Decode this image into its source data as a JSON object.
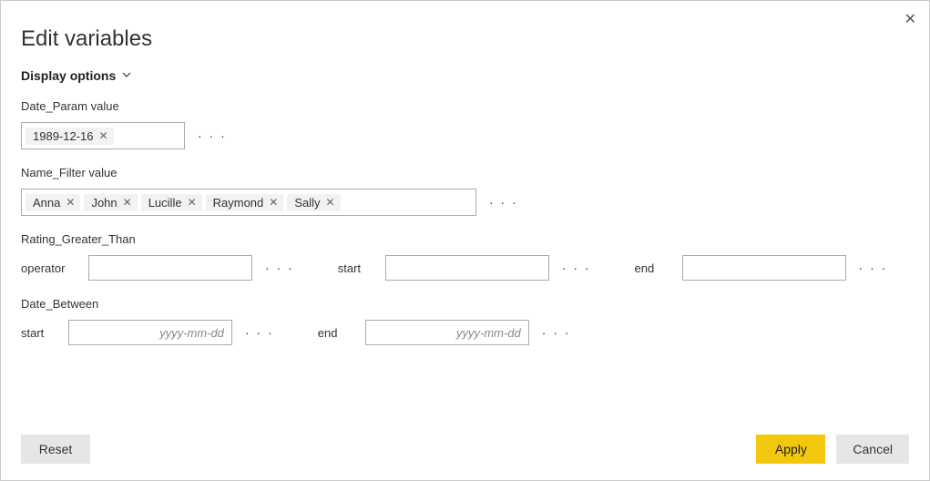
{
  "dialog": {
    "title": "Edit variables",
    "display_options_label": "Display options"
  },
  "date_param": {
    "label": "Date_Param value",
    "tokens": [
      "1989-12-16"
    ]
  },
  "name_filter": {
    "label": "Name_Filter value",
    "tokens": [
      "Anna",
      "John",
      "Lucille",
      "Raymond",
      "Sally"
    ]
  },
  "rating_greater_than": {
    "label": "Rating_Greater_Than",
    "operator_label": "operator",
    "operator_value": "",
    "start_label": "start",
    "start_value": "",
    "end_label": "end",
    "end_value": ""
  },
  "date_between": {
    "label": "Date_Between",
    "start_label": "start",
    "start_placeholder": "yyyy-mm-dd",
    "start_value": "",
    "end_label": "end",
    "end_placeholder": "yyyy-mm-dd",
    "end_value": ""
  },
  "buttons": {
    "reset": "Reset",
    "apply": "Apply",
    "cancel": "Cancel"
  },
  "icons": {
    "more": "· · ·"
  }
}
